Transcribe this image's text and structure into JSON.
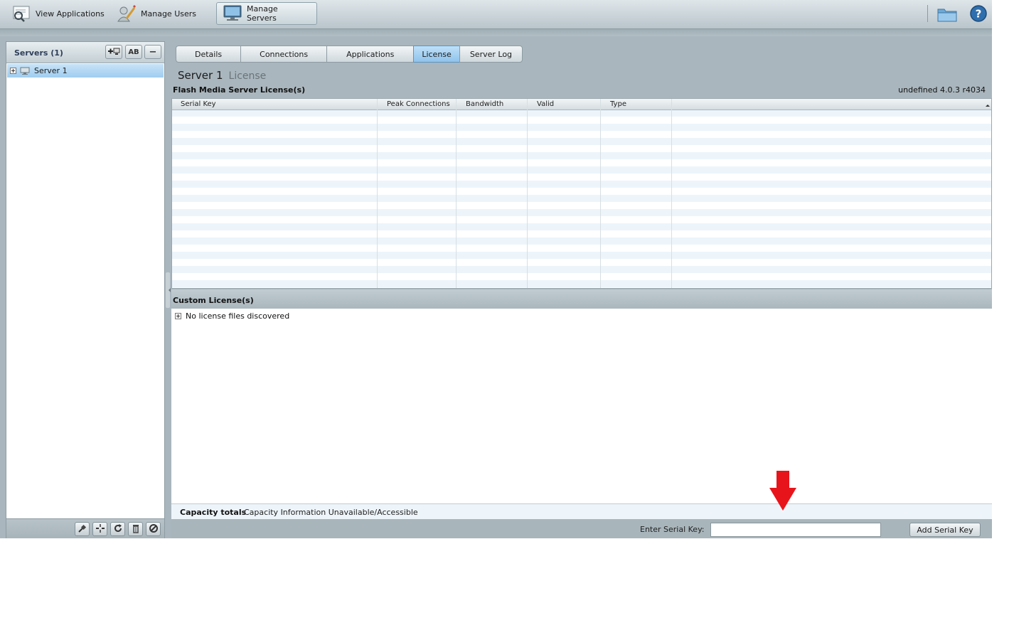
{
  "top_nav": {
    "items": [
      {
        "label": "View Applications",
        "icon": "magnifier-list-icon"
      },
      {
        "label": "Manage Users",
        "icon": "user-pencil-icon"
      },
      {
        "label": "Manage Servers",
        "icon": "monitor-icon",
        "active": true
      }
    ],
    "right_icons": [
      "folder-icon",
      "help-icon"
    ]
  },
  "sidebar": {
    "title": "Servers (1)",
    "header_buttons": [
      {
        "icon": "add-server-icon"
      },
      {
        "label": "AB",
        "icon": "rename-icon"
      },
      {
        "label": "−",
        "icon": "remove-icon"
      }
    ],
    "tree": [
      {
        "label": "Server 1",
        "selected": true
      }
    ],
    "footer_buttons": [
      "connect-icon",
      "disconnect-icon",
      "refresh-icon",
      "trash-icon",
      "cancel-icon"
    ]
  },
  "tabs": [
    {
      "label": "Details"
    },
    {
      "label": "Connections"
    },
    {
      "label": "Applications"
    },
    {
      "label": "License",
      "active": true
    },
    {
      "label": "Server Log"
    }
  ],
  "page": {
    "title": "Server 1",
    "subtitle": "License"
  },
  "license_section": {
    "title": "Flash Media Server License(s)",
    "version": "undefined 4.0.3 r4034",
    "columns": [
      "Serial Key",
      "Peak Connections",
      "Bandwidth",
      "Valid",
      "Type"
    ],
    "rows": []
  },
  "custom_section": {
    "title": "Custom License(s)",
    "empty_text": "No license files discovered"
  },
  "capacity": {
    "label": "Capacity totals",
    "value": "Capacity Information Unavailable/Accessible"
  },
  "serial_form": {
    "label": "Enter Serial Key:",
    "value": "",
    "button_label": "Add Serial Key"
  },
  "colors": {
    "accent": "#9fcdef",
    "annotation_arrow": "#e8141b"
  }
}
